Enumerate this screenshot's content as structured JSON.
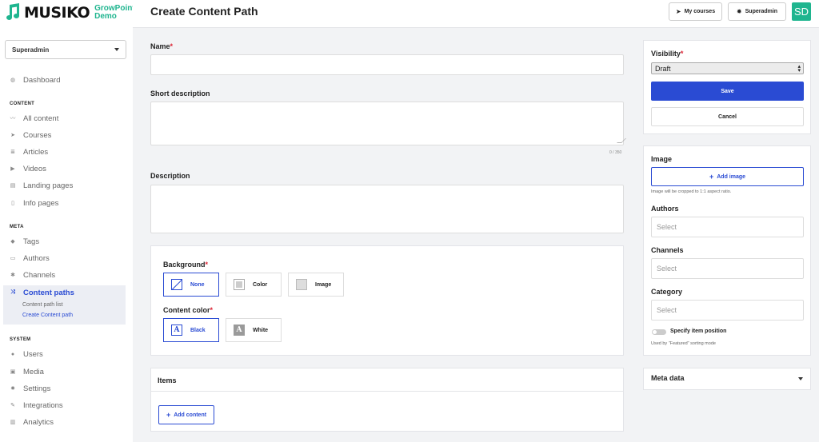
{
  "brand": {
    "name": "MUSIKO",
    "sub_line1": "GrowPoint",
    "sub_line2": "Demo",
    "accent": "#1fb58f"
  },
  "role_selector": {
    "value": "Superadmin",
    "icon": "chevron-down-icon"
  },
  "nav": {
    "dashboard": {
      "label": "Dashboard",
      "icon": "dashboard-icon"
    },
    "content_heading": "CONTENT",
    "content_items": [
      {
        "label": "All content",
        "icon": "rss-icon"
      },
      {
        "label": "Courses",
        "icon": "paper-plane-icon"
      },
      {
        "label": "Articles",
        "icon": "article-icon"
      },
      {
        "label": "Videos",
        "icon": "play-icon"
      },
      {
        "label": "Landing pages",
        "icon": "landing-page-icon"
      },
      {
        "label": "Info pages",
        "icon": "file-icon"
      }
    ],
    "meta_heading": "META",
    "meta_items": [
      {
        "label": "Tags",
        "icon": "tag-icon"
      },
      {
        "label": "Authors",
        "icon": "id-card-icon"
      },
      {
        "label": "Channels",
        "icon": "channels-icon"
      },
      {
        "label": "Content paths",
        "icon": "shuffle-icon"
      }
    ],
    "content_paths_sub": [
      "Content path list",
      "Create Content path"
    ],
    "system_heading": "SYSTEM",
    "system_items": [
      {
        "label": "Users",
        "icon": "user-icon"
      },
      {
        "label": "Media",
        "icon": "image-icon"
      },
      {
        "label": "Settings",
        "icon": "gear-icon"
      },
      {
        "label": "Integrations",
        "icon": "plug-icon"
      },
      {
        "label": "Analytics",
        "icon": "bar-chart-icon"
      }
    ]
  },
  "header": {
    "title": "Create Content Path",
    "my_courses": "My courses",
    "user_menu": "Superadmin",
    "avatar": "SD",
    "accent": "#1fb58f"
  },
  "form": {
    "name_label": "Name",
    "name_value": "",
    "short_desc_label": "Short description",
    "short_desc_value": "",
    "short_desc_counter": "0 / 350",
    "description_label": "Description",
    "description_value": "",
    "required_mark": "*"
  },
  "appearance": {
    "background_label": "Background",
    "background_options": [
      "None",
      "Color",
      "Image"
    ],
    "background_selected": "None",
    "content_color_label": "Content color",
    "content_color_options": [
      "Black",
      "White"
    ],
    "content_color_selected": "Black"
  },
  "items": {
    "heading": "Items",
    "add_button": "Add content"
  },
  "publish": {
    "visibility_label": "Visibility",
    "visibility_value": "Draft",
    "save": "Save",
    "cancel": "Cancel",
    "primary_color": "#2a4bd3"
  },
  "attributes": {
    "image_label": "Image",
    "add_image": "Add image",
    "image_hint": "Image will be cropped to 1:1 aspect ratio.",
    "authors_label": "Authors",
    "authors_placeholder": "Select",
    "channels_label": "Channels",
    "channels_placeholder": "Select",
    "category_label": "Category",
    "category_placeholder": "Select",
    "position_toggle_label": "Specify item position",
    "position_hint": "Used by \"Featured\" sorting mode"
  },
  "meta_data": {
    "label": "Meta data"
  }
}
